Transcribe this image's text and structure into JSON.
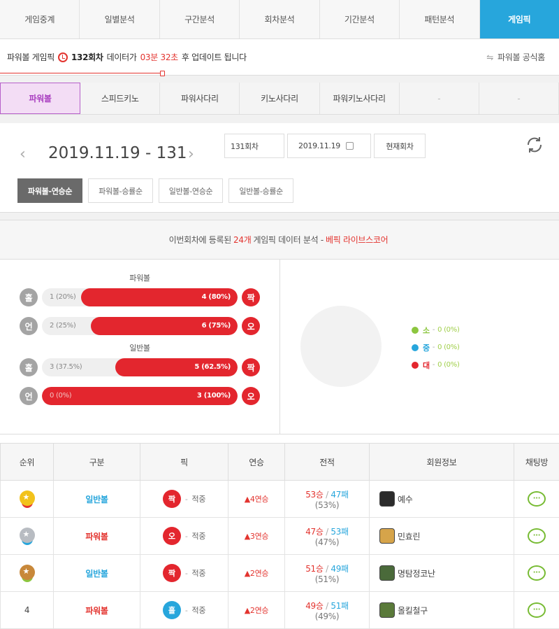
{
  "topnav": {
    "tabs": [
      "게임중계",
      "일별분석",
      "구간분석",
      "회차분석",
      "기간분석",
      "패턴분석",
      "게임픽"
    ],
    "active_index": 6
  },
  "infobar": {
    "game": "파워볼 게임픽",
    "round": "132회차",
    "label_mid": "데이터가",
    "time": "03분 32초",
    "label_end": "후 업데이트 됩니다",
    "official_link": "파워볼 공식홈"
  },
  "gametabs": {
    "tabs": [
      "파워볼",
      "스피드키노",
      "파워사다리",
      "키노사다리",
      "파워키노사다리",
      "-",
      "-"
    ],
    "active_index": 0
  },
  "date": {
    "title": "2019.11.19 - 131",
    "prev_icon": "chevron-left-icon",
    "next_icon": "chevron-right-icon",
    "round_field": "131회차",
    "date_field": "2019.11.19",
    "current_button": "현재회차",
    "sort_options": [
      "파워볼-연승순",
      "파워볼-승률순",
      "일반볼-연승순",
      "일반볼-승률순"
    ],
    "sort_active": 0
  },
  "analysis": {
    "head_pre": "이번회차에 등록된",
    "count": "24개",
    "head_mid": "게임픽 데이터 분석 -",
    "head_brand": "베픽 라이브스코어",
    "powerball_title": "파워볼",
    "normal_title": "일반볼",
    "bars": [
      {
        "left_label": "홀",
        "left_text": "1 (20%)",
        "right_text": "4 (80%)",
        "right_label": "짝",
        "right_fraction": 0.8
      },
      {
        "left_label": "언",
        "left_text": "2 (25%)",
        "right_text": "6 (75%)",
        "right_label": "오",
        "right_fraction": 0.75
      },
      {
        "left_label": "홀",
        "left_text": "3 (37.5%)",
        "right_text": "5 (62.5%)",
        "right_label": "짝",
        "right_fraction": 0.625
      },
      {
        "left_label": "언",
        "left_text": "0 (0%)",
        "right_text": "3 (100%)",
        "right_label": "오",
        "right_fraction": 1.0
      }
    ],
    "legend": [
      {
        "label": "소",
        "value": "0 (0%)",
        "color": "#8cc63f"
      },
      {
        "label": "중",
        "value": "0 (0%)",
        "color": "#27a6dc"
      },
      {
        "label": "대",
        "value": "0 (0%)",
        "color": "#e3262e"
      }
    ]
  },
  "table": {
    "headers": [
      "순위",
      "구분",
      "픽",
      "연승",
      "전적",
      "회원정보",
      "채팅방"
    ],
    "rows": [
      {
        "rank": "",
        "medal": "gold",
        "kind": "일반볼",
        "kind_color": "#27a6dc",
        "pick": "짝",
        "pick_color": "#e3262e",
        "result": "적중",
        "streak": "▲4연승",
        "wins": "53승",
        "losses": "47패",
        "pct": "(53%)",
        "member": "예수"
      },
      {
        "rank": "",
        "medal": "silver",
        "kind": "파워볼",
        "kind_color": "#e3342f",
        "pick": "오",
        "pick_color": "#e3262e",
        "result": "적중",
        "streak": "▲3연승",
        "wins": "47승",
        "losses": "53패",
        "pct": "(47%)",
        "member": "민효린"
      },
      {
        "rank": "",
        "medal": "bronze",
        "kind": "일반볼",
        "kind_color": "#27a6dc",
        "pick": "짝",
        "pick_color": "#e3262e",
        "result": "적중",
        "streak": "▲2연승",
        "wins": "51승",
        "losses": "49패",
        "pct": "(51%)",
        "member": "명탐정코난"
      },
      {
        "rank": "4",
        "medal": "",
        "kind": "파워볼",
        "kind_color": "#e3342f",
        "pick": "홀",
        "pick_color": "#27a6dc",
        "result": "적중",
        "streak": "▲2연승",
        "wins": "49승",
        "losses": "51패",
        "pct": "(49%)",
        "member": "올킬철구"
      }
    ]
  }
}
